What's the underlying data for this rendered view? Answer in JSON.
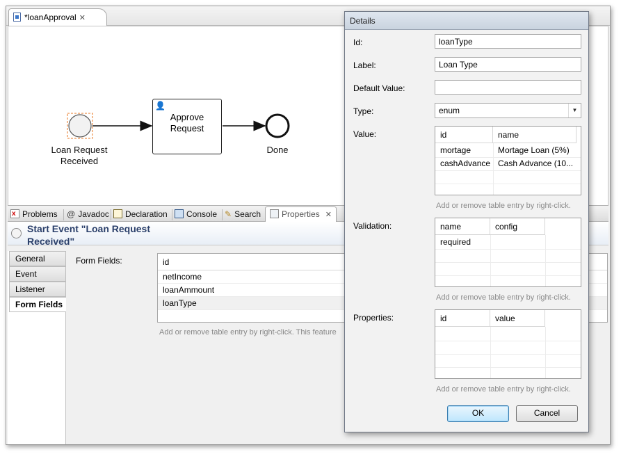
{
  "editor": {
    "tab_title": "*loanApproval",
    "diagram": {
      "start_event_label": "Loan Request Received",
      "task_label": "Approve Request",
      "end_event_label": "Done"
    }
  },
  "views": {
    "tabs": [
      {
        "label": "Problems",
        "icon": "problems-icon"
      },
      {
        "label": "Javadoc",
        "icon": "at-icon"
      },
      {
        "label": "Declaration",
        "icon": "declaration-icon"
      },
      {
        "label": "Console",
        "icon": "console-icon"
      },
      {
        "label": "Search",
        "icon": "search-icon"
      },
      {
        "label": "Properties",
        "icon": "properties-icon",
        "active": true
      }
    ]
  },
  "properties": {
    "header_title": "Start Event \"Loan Request Received\"",
    "side_tabs": [
      "General",
      "Event",
      "Listener",
      "Form Fields"
    ],
    "active_side_tab": "Form Fields",
    "form_fields_label": "Form Fields:",
    "table": {
      "header": "id",
      "rows": [
        "netIncome",
        "loanAmmount",
        "loanType"
      ],
      "selected": "loanType"
    },
    "hint": "Add or remove table entry by right-click. This feature"
  },
  "dialog": {
    "title": "Details",
    "id_label": "Id:",
    "id_value": "loanType",
    "label_label": "Label:",
    "label_value": "Loan Type",
    "default_label": "Default Value:",
    "default_value": "",
    "type_label": "Type:",
    "type_value": "enum",
    "value_label": "Value:",
    "value_table": {
      "columns": [
        "id",
        "name"
      ],
      "rows": [
        [
          "mortage",
          "Mortage Loan (5%)"
        ],
        [
          "cashAdvance",
          "Cash Advance (10..."
        ]
      ]
    },
    "value_hint": "Add or remove table entry by right-click.",
    "validation_label": "Validation:",
    "validation_table": {
      "columns": [
        "name",
        "config"
      ],
      "rows": [
        [
          "required",
          ""
        ]
      ]
    },
    "validation_hint": "Add or remove table entry by right-click.",
    "properties_label": "Properties:",
    "properties_table": {
      "columns": [
        "id",
        "value"
      ],
      "rows": []
    },
    "properties_hint": "Add or remove table entry by right-click.",
    "ok_label": "OK",
    "cancel_label": "Cancel"
  },
  "colors": {
    "header_title": "#2a3f6a",
    "default_button": "#3c7fb1",
    "start_event_selection": "#e87722"
  }
}
